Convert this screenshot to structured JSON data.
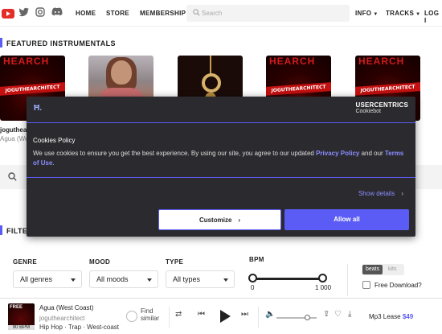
{
  "nav": {
    "links": [
      "HOME",
      "STORE",
      "MEMBERSHIP"
    ],
    "search_placeholder": "Search",
    "info": "INFO",
    "tracks": "TRACKS",
    "login": "LOG I"
  },
  "featured": {
    "title": "FEATURED INSTRUMENTALS",
    "cover_text": "JOGUTHEARCHITECT",
    "cover_top": "HEARCH",
    "captions": [
      "joguthear",
      "Agua (Wes"
    ]
  },
  "filters": {
    "title": "FILTER",
    "genre_label": "GENRE",
    "genre_value": "All genres",
    "mood_label": "MOOD",
    "mood_value": "All moods",
    "type_label": "TYPE",
    "type_value": "All types",
    "bpm_label": "BPM",
    "bpm_min": "0",
    "bpm_max": "1 000",
    "seg_beats": "beats",
    "seg_kits": "kits",
    "free_download": "Free Download?"
  },
  "cookie": {
    "brand_line1": "USERCENTRICS",
    "brand_line2": "Cookiebot",
    "title": "Cookies Policy",
    "text_before": "We use cookies to ensure you get the best experience. By using our site, you agree to our updated ",
    "privacy_link": "Privacy Policy",
    "text_and": " and our ",
    "terms_link": "Terms of Use",
    "text_end": ".",
    "show_details": "Show details",
    "customize": "Customize",
    "allow_all": "Allow all"
  },
  "player": {
    "free_badge": "FREE",
    "bpm_badge": "90 BPM",
    "title": "Agua (West Coast)",
    "artist": "joguthearchitect",
    "tags": "Hip Hop · Trap · West-coast",
    "find_similar": "Find similar",
    "lease": "Mp3 Lease",
    "price": "$49"
  },
  "colors": {
    "accent": "#5b5cf5",
    "dialog_bg": "#2b2b2f",
    "youtube": "#e52d27"
  }
}
